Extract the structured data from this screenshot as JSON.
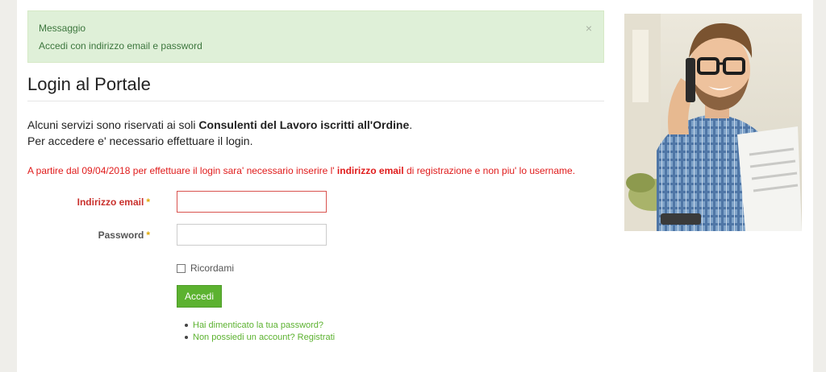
{
  "alert": {
    "title": "Messaggio",
    "message": "Accedi con indirizzo email e password",
    "close_glyph": "×"
  },
  "heading": "Login al Portale",
  "intro": {
    "line1_prefix": "Alcuni servizi sono riservati ai soli ",
    "line1_bold": "Consulenti del Lavoro iscritti all'Ordine",
    "line1_suffix": ".",
    "line2": "Per accedere e' necessario effettuare il login."
  },
  "warning": {
    "prefix": "A partire dal 09/04/2018 per effettuare il login sara' necessario inserire l' ",
    "bold": "indirizzo email",
    "suffix": " di registrazione e non piu' lo username."
  },
  "form": {
    "email_label": "Indirizzo email",
    "password_label": "Password",
    "required_mark": "*",
    "email_value": "",
    "password_value": "",
    "remember_label": "Ricordami",
    "remember_checked": false,
    "submit_label": "Accedi"
  },
  "links": {
    "forgot": "Hai dimenticato la tua password?",
    "register": "Non possiedi un account? Registrati"
  },
  "colors": {
    "accent_green": "#5cb230",
    "alert_bg": "#dff0d8",
    "error_red": "#e01b1b"
  },
  "photo": {
    "icon": "man-on-phone-photo"
  }
}
